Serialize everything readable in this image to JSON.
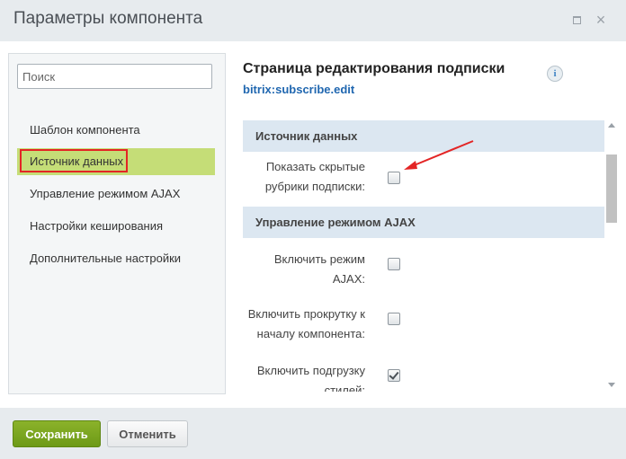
{
  "window": {
    "title": "Параметры компонента",
    "close_glyph": "×",
    "icons": {
      "maximize": "maximize-icon",
      "close": "close-icon"
    }
  },
  "sidebar": {
    "search_placeholder": "Поиск",
    "items": [
      {
        "label": "Шаблон компонента",
        "active": false
      },
      {
        "label": "Источник данных",
        "active": true
      },
      {
        "label": "Управление режимом AJAX",
        "active": false
      },
      {
        "label": "Настройки кеширования",
        "active": false
      },
      {
        "label": "Дополнительные настройки",
        "active": false
      }
    ]
  },
  "main": {
    "title": "Страница редактирования подписки",
    "info_glyph": "i",
    "component_code": "bitrix:subscribe.edit",
    "sections": [
      {
        "title": "Источник данных",
        "fields": [
          {
            "label_lines": [
              "Показать скрытые",
              "рубрики подписки:"
            ],
            "checked": false
          }
        ]
      },
      {
        "title": "Управление режимом AJAX",
        "fields": [
          {
            "label_lines": [
              "Включить режим",
              "AJAX:"
            ],
            "checked": false
          },
          {
            "label_lines": [
              "Включить прокрутку к",
              "началу компонента:"
            ],
            "checked": false
          },
          {
            "label_lines": [
              "Включить подгрузку",
              "стилей:"
            ],
            "checked": true
          }
        ]
      }
    ]
  },
  "footer": {
    "save_label": "Сохранить",
    "cancel_label": "Отменить"
  },
  "colors": {
    "accent_green": "#6d9a17",
    "active_item": "#c5dd77",
    "highlight_red": "#e32525",
    "link_blue": "#2067b0"
  }
}
